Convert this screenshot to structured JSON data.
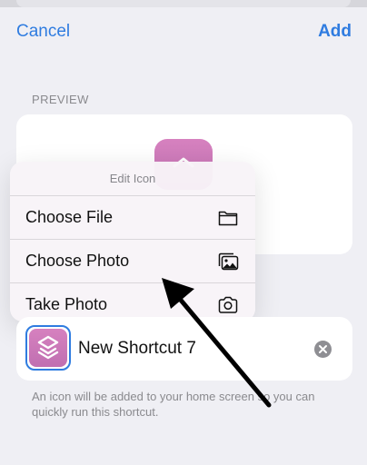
{
  "nav": {
    "cancel_label": "Cancel",
    "add_label": "Add"
  },
  "preview": {
    "section_label": "PREVIEW"
  },
  "popup": {
    "title": "Edit Icon",
    "items": [
      {
        "label": "Choose File",
        "icon": "folder-icon"
      },
      {
        "label": "Choose Photo",
        "icon": "photos-icon"
      },
      {
        "label": "Take Photo",
        "icon": "camera-icon"
      }
    ]
  },
  "shortcut": {
    "name": "New Shortcut 7",
    "icon": "shortcuts-icon",
    "icon_color": "#d07cbb"
  },
  "helper_text": "An icon will be added to your home screen so you can quickly run this shortcut.",
  "colors": {
    "accent": "#2f7ce0",
    "background": "#efeff4",
    "annotation_arrow": "#000000"
  }
}
